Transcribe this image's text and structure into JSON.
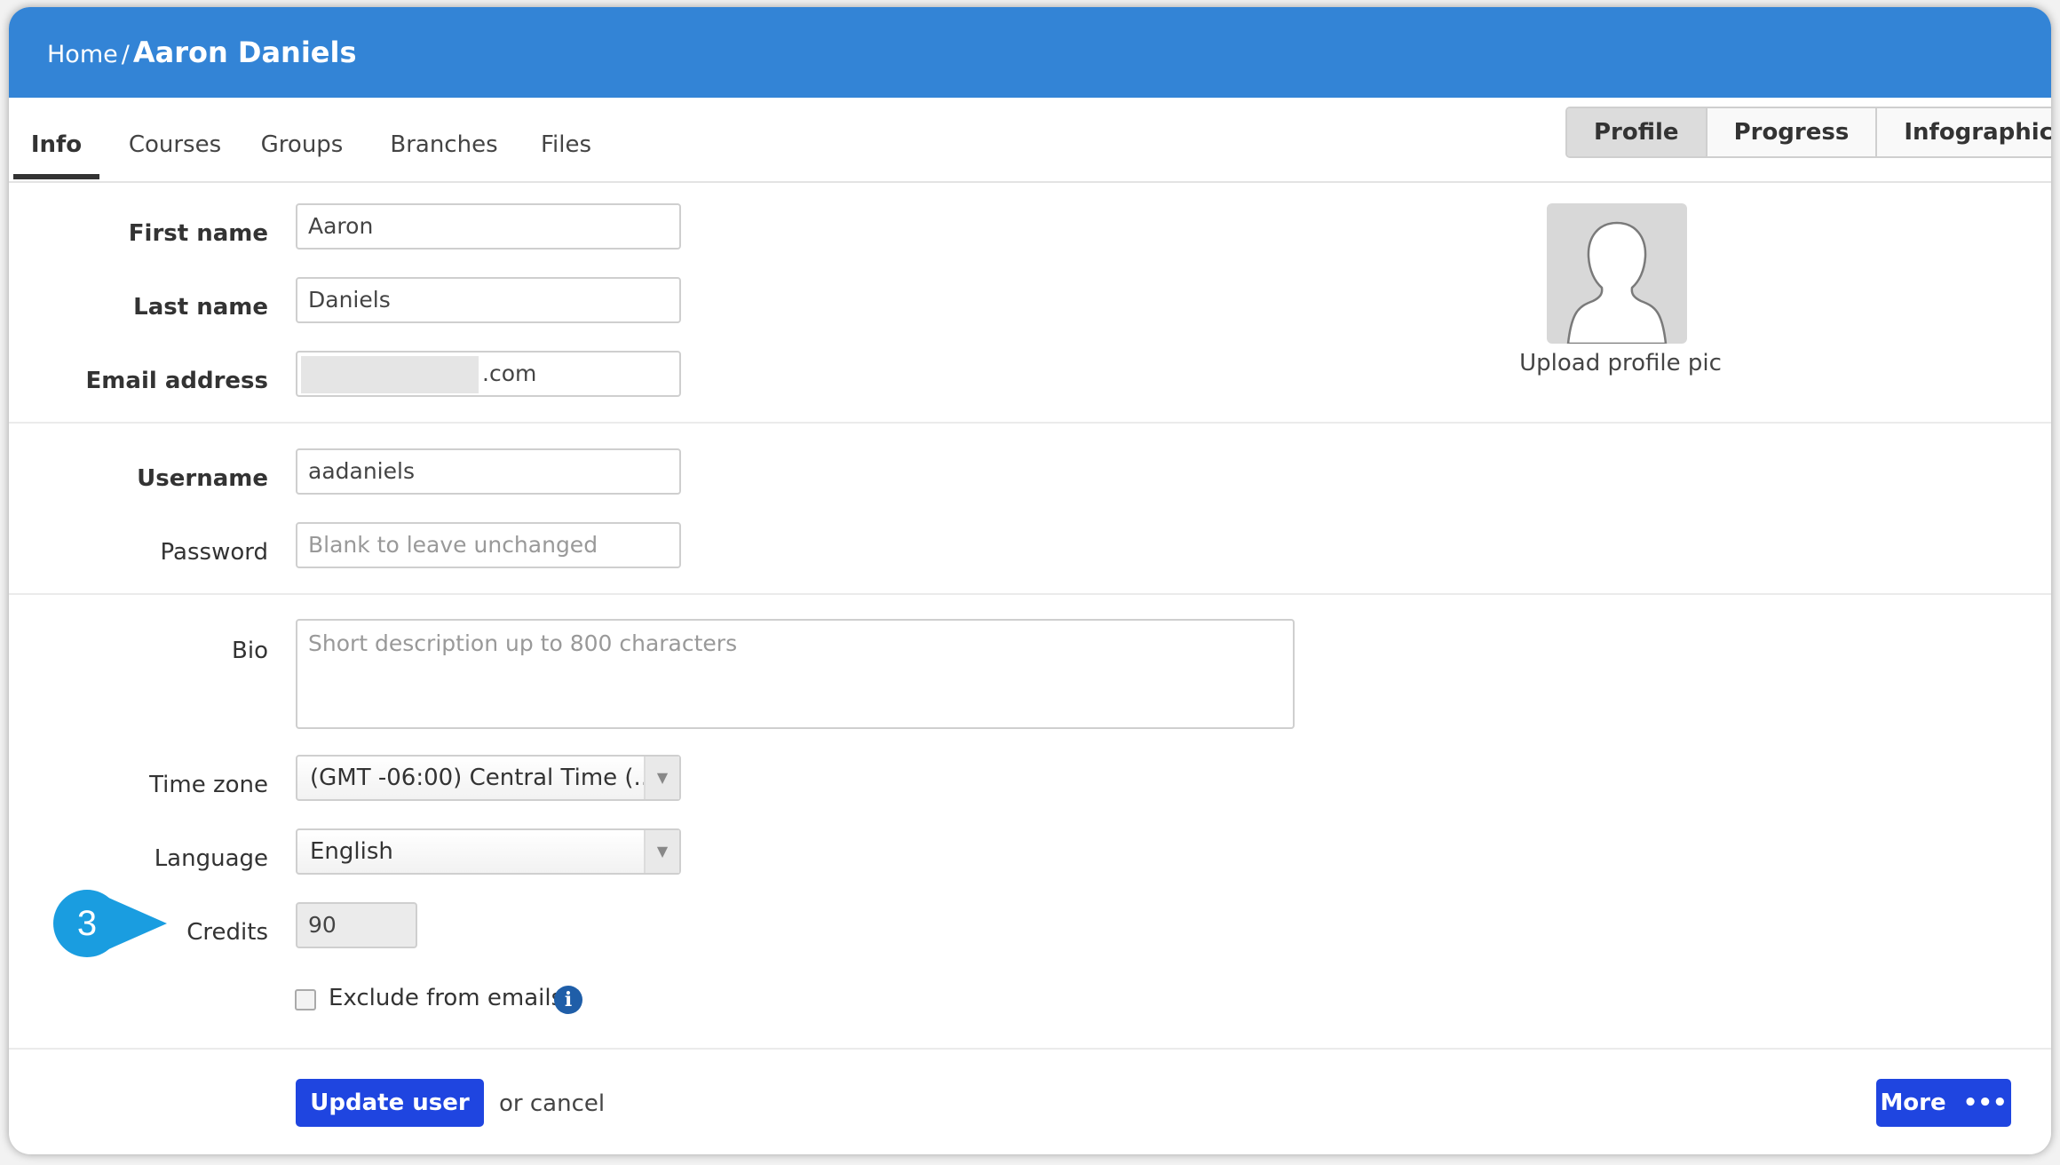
{
  "breadcrumb": {
    "home": "Home",
    "separator": "/",
    "current": "Aaron Daniels"
  },
  "tabs": [
    {
      "label": "Info",
      "active": true
    },
    {
      "label": "Courses",
      "active": false
    },
    {
      "label": "Groups",
      "active": false
    },
    {
      "label": "Branches",
      "active": false
    },
    {
      "label": "Files",
      "active": false
    }
  ],
  "view_toggle": {
    "profile": "Profile",
    "progress": "Progress",
    "infographic": "Infographic",
    "selected": "Profile"
  },
  "form": {
    "first_name": {
      "label": "First name",
      "value": "Aaron"
    },
    "last_name": {
      "label": "Last name",
      "value": "Daniels"
    },
    "email": {
      "label": "Email address",
      "value_suffix": ".com"
    },
    "username": {
      "label": "Username",
      "value": "aadaniels"
    },
    "password": {
      "label": "Password",
      "placeholder": "Blank to leave unchanged"
    },
    "bio": {
      "label": "Bio",
      "placeholder": "Short description up to 800 characters"
    },
    "time_zone": {
      "label": "Time zone",
      "value": "(GMT -06:00) Central Time (..."
    },
    "language": {
      "label": "Language",
      "value": "English"
    },
    "credits": {
      "label": "Credits",
      "value": "90"
    },
    "exclude_emails": {
      "label": "Exclude from emails",
      "checked": false
    }
  },
  "profile_pic": {
    "upload_label": "Upload profile pic"
  },
  "actions": {
    "update": "Update user",
    "or_cancel": "or cancel",
    "more": "More"
  },
  "callout": {
    "number": "3",
    "color": "#1a9de0"
  },
  "colors": {
    "header": "#3384d6",
    "primary_button": "#1f45e0",
    "info_icon": "#1f5ea8"
  }
}
